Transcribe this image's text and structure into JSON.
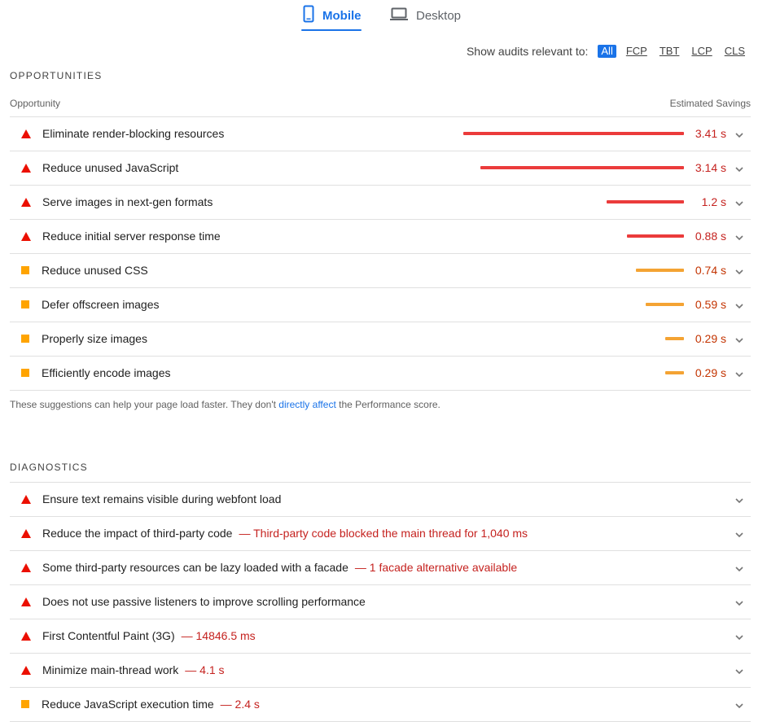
{
  "tabs": [
    {
      "label": "Mobile",
      "icon": "phone-icon",
      "active": true
    },
    {
      "label": "Desktop",
      "icon": "laptop-icon",
      "active": false
    }
  ],
  "filter": {
    "label": "Show audits relevant to:",
    "chips": [
      "All",
      "FCP",
      "TBT",
      "LCP",
      "CLS"
    ],
    "active": "All"
  },
  "opportunities": {
    "title": "OPPORTUNITIES",
    "col_left": "Opportunity",
    "col_right": "Estimated Savings",
    "items": [
      {
        "title": "Eliminate render-blocking resources",
        "savings": "3.41 s",
        "seconds": 3.41,
        "status": "fail"
      },
      {
        "title": "Reduce unused JavaScript",
        "savings": "3.14 s",
        "seconds": 3.14,
        "status": "fail"
      },
      {
        "title": "Serve images in next-gen formats",
        "savings": "1.2 s",
        "seconds": 1.2,
        "status": "fail"
      },
      {
        "title": "Reduce initial server response time",
        "savings": "0.88 s",
        "seconds": 0.88,
        "status": "fail"
      },
      {
        "title": "Reduce unused CSS",
        "savings": "0.74 s",
        "seconds": 0.74,
        "status": "average"
      },
      {
        "title": "Defer offscreen images",
        "savings": "0.59 s",
        "seconds": 0.59,
        "status": "average"
      },
      {
        "title": "Properly size images",
        "savings": "0.29 s",
        "seconds": 0.29,
        "status": "average"
      },
      {
        "title": "Efficiently encode images",
        "savings": "0.29 s",
        "seconds": 0.29,
        "status": "average"
      }
    ],
    "footnote_pre": "These suggestions can help your page load faster. They don't ",
    "footnote_link": "directly affect",
    "footnote_post": " the Performance score."
  },
  "diagnostics": {
    "title": "DIAGNOSTICS",
    "items": [
      {
        "title": "Ensure text remains visible during webfont load",
        "meta": "",
        "status": "fail"
      },
      {
        "title": "Reduce the impact of third-party code",
        "meta": "— Third-party code blocked the main thread for 1,040 ms",
        "status": "fail"
      },
      {
        "title": "Some third-party resources can be lazy loaded with a facade",
        "meta": "— 1 facade alternative available",
        "status": "fail"
      },
      {
        "title": "Does not use passive listeners to improve scrolling performance",
        "meta": "",
        "status": "fail"
      },
      {
        "title": "First Contentful Paint (3G)",
        "meta": "— 14846.5 ms",
        "status": "fail"
      },
      {
        "title": "Minimize main-thread work",
        "meta": "— 4.1 s",
        "status": "fail"
      },
      {
        "title": "Reduce JavaScript execution time",
        "meta": "— 2.4 s",
        "status": "average"
      }
    ]
  },
  "colors": {
    "accent": "#1a73e8",
    "fail": "#eb0f00",
    "average": "#ffa400",
    "fail_text": "#c5221f",
    "average_text": "#c33300"
  }
}
